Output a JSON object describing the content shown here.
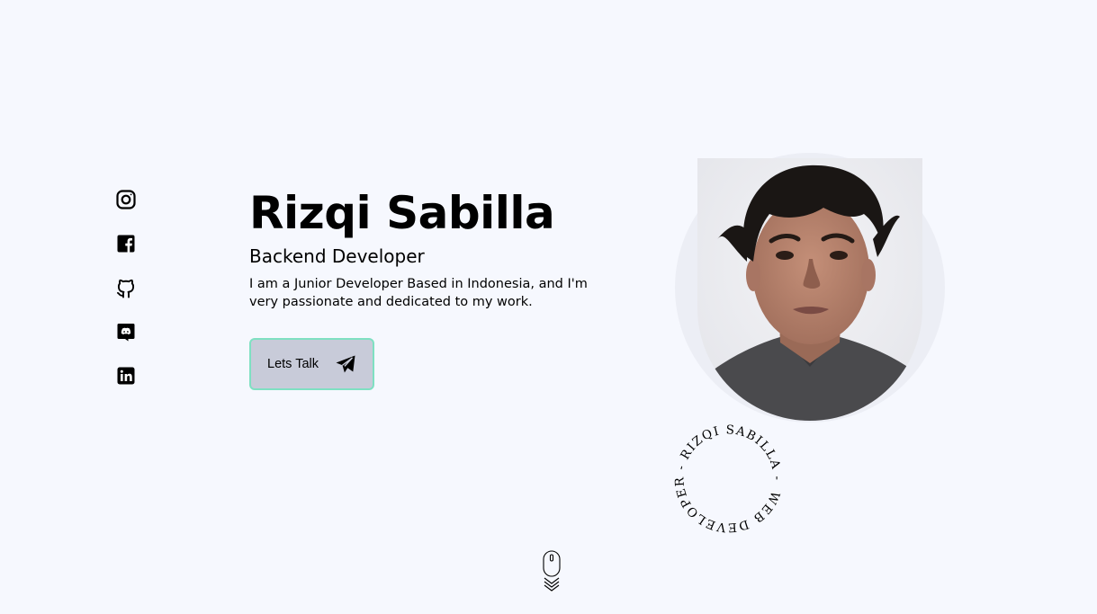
{
  "socials": [
    {
      "name": "instagram-icon"
    },
    {
      "name": "facebook-icon"
    },
    {
      "name": "github-icon"
    },
    {
      "name": "discord-icon"
    },
    {
      "name": "linkedin-icon"
    }
  ],
  "hero": {
    "name": "Rizqi Sabilla",
    "role": "Backend Developer",
    "bio": "I am a Junior Developer Based in Indonesia, and I'm very passionate and dedicated to my work."
  },
  "cta": {
    "label": "Lets Talk",
    "icon": "send-icon"
  },
  "badge": {
    "text": "WEB DEVELOPER - RIZQI SABILLA -"
  },
  "scroll": {
    "icon": "mouse-scroll-icon"
  },
  "colors": {
    "background": "#f6f8fe",
    "button_bg": "#c8cbd9",
    "button_border": "#7fe0c2"
  }
}
